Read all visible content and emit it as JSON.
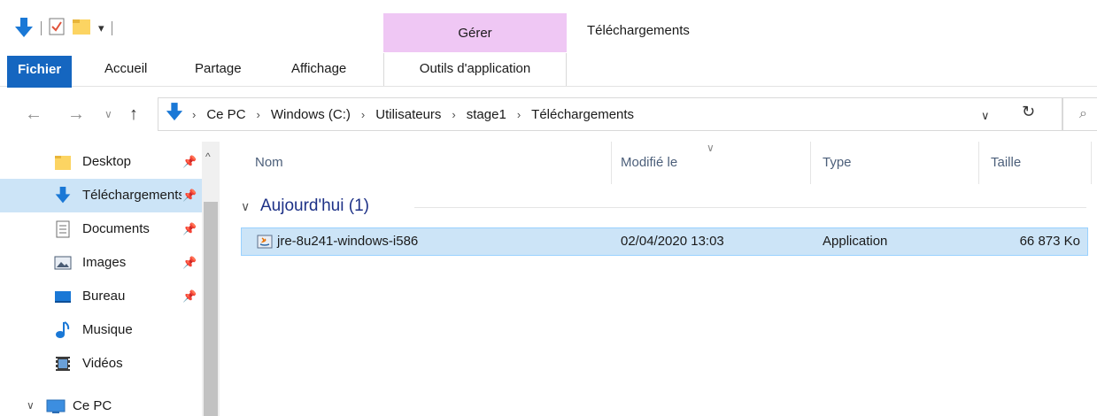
{
  "titlebar": {
    "context_tab_group": "Gérer",
    "window_title": "Téléchargements"
  },
  "ribbon": {
    "tabs": [
      "Fichier",
      "Accueil",
      "Partage",
      "Affichage"
    ],
    "context_tab": "Outils d'application"
  },
  "address": {
    "breadcrumbs": [
      "Ce PC",
      "Windows (C:)",
      "Utilisateurs",
      "stage1",
      "Téléchargements"
    ],
    "separator": "›"
  },
  "sidebar": {
    "items": [
      {
        "label": "Desktop",
        "icon": "folder-icon",
        "pinned": true
      },
      {
        "label": "Téléchargements",
        "icon": "download-arrow-icon",
        "pinned": true,
        "selected": true
      },
      {
        "label": "Documents",
        "icon": "documents-icon",
        "pinned": true
      },
      {
        "label": "Images",
        "icon": "images-icon",
        "pinned": true
      },
      {
        "label": "Bureau",
        "icon": "desktop-icon",
        "pinned": true
      },
      {
        "label": "Musique",
        "icon": "music-note-icon",
        "pinned": false
      },
      {
        "label": "Vidéos",
        "icon": "videos-icon",
        "pinned": false
      },
      {
        "label": "Ce PC",
        "icon": "pc-icon",
        "pinned": false
      }
    ]
  },
  "filelist": {
    "columns": [
      "Nom",
      "Modifié le",
      "Type",
      "Taille"
    ],
    "group_title": "Aujourd'hui (1)",
    "files": [
      {
        "name": "jre-8u241-windows-i586",
        "modified": "02/04/2020 13:03",
        "type": "Application",
        "size": "66 873 Ko",
        "icon": "java-installer-icon"
      }
    ]
  },
  "colors": {
    "accent": "#1566c0",
    "context_tab": "#efc7f4",
    "selection": "#cce4f7",
    "group_title": "#1e3287"
  }
}
